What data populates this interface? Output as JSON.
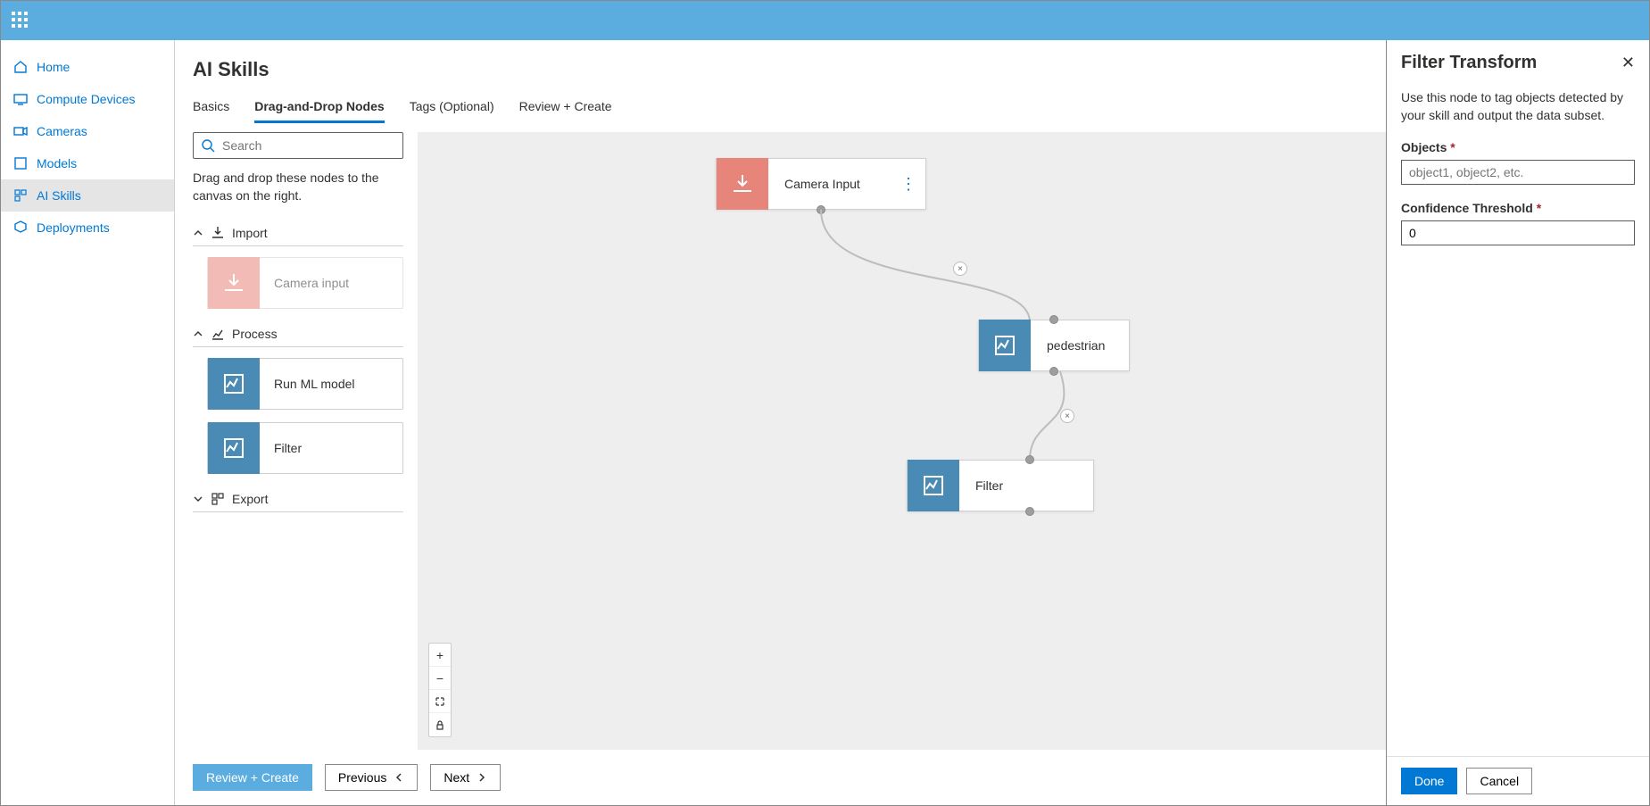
{
  "sidebar": {
    "items": [
      {
        "label": "Home"
      },
      {
        "label": "Compute Devices"
      },
      {
        "label": "Cameras"
      },
      {
        "label": "Models"
      },
      {
        "label": "AI Skills"
      },
      {
        "label": "Deployments"
      }
    ]
  },
  "page": {
    "title": "AI Skills"
  },
  "tabs": [
    {
      "label": "Basics"
    },
    {
      "label": "Drag-and-Drop Nodes"
    },
    {
      "label": "Tags (Optional)"
    },
    {
      "label": "Review + Create"
    }
  ],
  "palette": {
    "search_placeholder": "Search",
    "help": "Drag and drop these nodes to the canvas on the right.",
    "groups": {
      "import": {
        "label": "Import",
        "items": [
          {
            "label": "Camera input"
          }
        ]
      },
      "process": {
        "label": "Process",
        "items": [
          {
            "label": "Run ML model"
          },
          {
            "label": "Filter"
          }
        ]
      },
      "export": {
        "label": "Export"
      }
    }
  },
  "canvas": {
    "nodes": [
      {
        "label": "Camera Input"
      },
      {
        "label": "pedestrian"
      },
      {
        "label": "Filter"
      }
    ]
  },
  "footer": {
    "review": "Review + Create",
    "previous": "Previous",
    "next": "Next"
  },
  "panel": {
    "title": "Filter Transform",
    "desc": "Use this node to tag objects detected by your skill and output the data subset.",
    "objects_label": "Objects",
    "objects_placeholder": "object1, object2, etc.",
    "threshold_label": "Confidence Threshold",
    "threshold_value": "0",
    "done": "Done",
    "cancel": "Cancel"
  }
}
